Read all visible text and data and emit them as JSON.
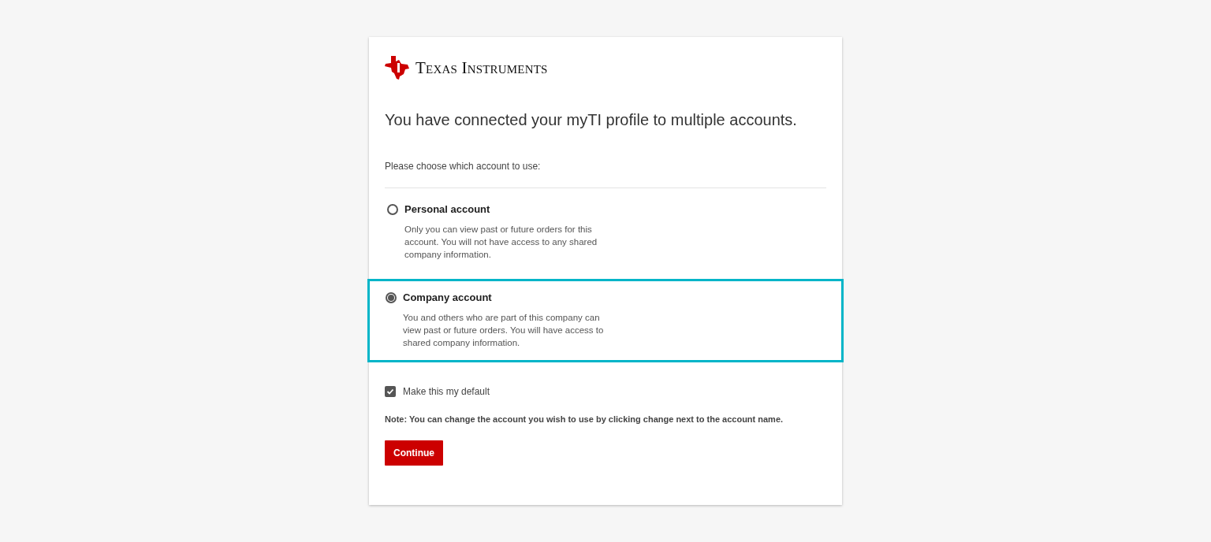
{
  "logo": {
    "name": "Texas Instruments"
  },
  "heading": "You have connected your myTI profile to multiple accounts.",
  "prompt": "Please choose which account to use:",
  "options": [
    {
      "label": "Personal account",
      "description": "Only you can view past or future orders for this account. You will not have access to any shared company information.",
      "selected": false
    },
    {
      "label": "Company account",
      "description": "You and others who are part of this company can view past or future orders. You will have access to shared company information.",
      "selected": true
    }
  ],
  "default_checkbox": {
    "label": "Make this my default",
    "checked": true
  },
  "note": "Note: You can change the account you wish to use by clicking change next to the account name.",
  "continue_button": "Continue"
}
